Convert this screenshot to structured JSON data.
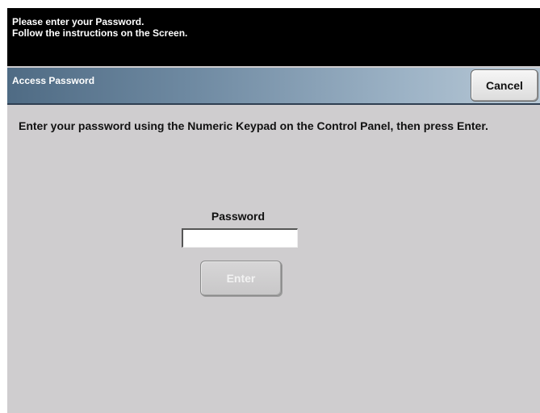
{
  "message": {
    "line1": "Please enter your Password.",
    "line2": "Follow the instructions on the Screen."
  },
  "header": {
    "title": "Access Password",
    "cancel_label": "Cancel"
  },
  "main": {
    "instruction": "Enter your password using the Numeric Keypad on the Control Panel, then press Enter.",
    "password_label": "Password",
    "password_value": "",
    "enter_label": "Enter",
    "enter_disabled": true
  },
  "colors": {
    "message_bar": "#000000",
    "title_bar": "#6f8aa2",
    "screen_bg": "#cfcdcf"
  }
}
